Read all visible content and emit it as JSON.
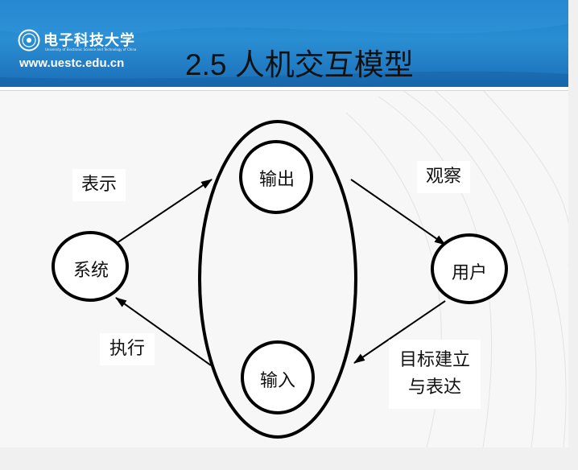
{
  "header": {
    "title": "2.5 人机交互模型",
    "logo_text": "电子科技大学",
    "logo_subtitle": "University of Electronic Science and Technology of China",
    "url": "www.uestc.edu.cn"
  },
  "diagram": {
    "center_nodes": {
      "output": "输出",
      "input": "输入"
    },
    "system": "系统",
    "user": "用户",
    "labels": {
      "present": "表示",
      "observe": "观察",
      "execute": "执行",
      "goal_line1": "目标建立",
      "goal_line2": "与表达"
    }
  },
  "colors": {
    "header_blue": "#1c7fc9",
    "stroke": "#000000"
  }
}
